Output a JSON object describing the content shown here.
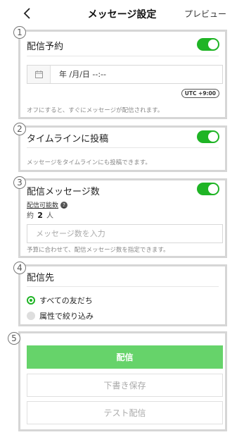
{
  "header": {
    "back_icon": "chevron-left-icon",
    "title": "メッセージ設定",
    "preview_label": "プレビュー"
  },
  "badges": [
    "1",
    "2",
    "3",
    "4",
    "5"
  ],
  "schedule": {
    "title": "配信予約",
    "enabled": true,
    "date_value": "年 /月/日 --:--",
    "calendar_icon": "calendar-icon",
    "timezone": "UTC +9:00",
    "help": "オフにすると、すぐにメッセージが配信されます。"
  },
  "timeline": {
    "title": "タイムラインに投稿",
    "enabled": true,
    "help": "メッセージをタイムラインにも投稿できます。"
  },
  "message_count": {
    "title": "配信メッセージ数",
    "enabled": true,
    "available_label": "配信可能数",
    "help_icon": "question-icon",
    "approx_label": "約",
    "count": "2",
    "unit": "人",
    "placeholder": "メッセージ数を入力",
    "help": "予算に合わせて、配信メッセージ数を指定できます。"
  },
  "recipients": {
    "title": "配信先",
    "options": [
      {
        "label": "すべての友だち",
        "selected": true
      },
      {
        "label": "属性で絞り込み",
        "selected": false
      }
    ]
  },
  "actions": {
    "send_label": "配信",
    "draft_label": "下書き保存",
    "test_label": "テスト配信"
  },
  "colors": {
    "accent": "#1fb425",
    "primary_button": "#66d36a",
    "card_border": "#d6d6d6"
  }
}
